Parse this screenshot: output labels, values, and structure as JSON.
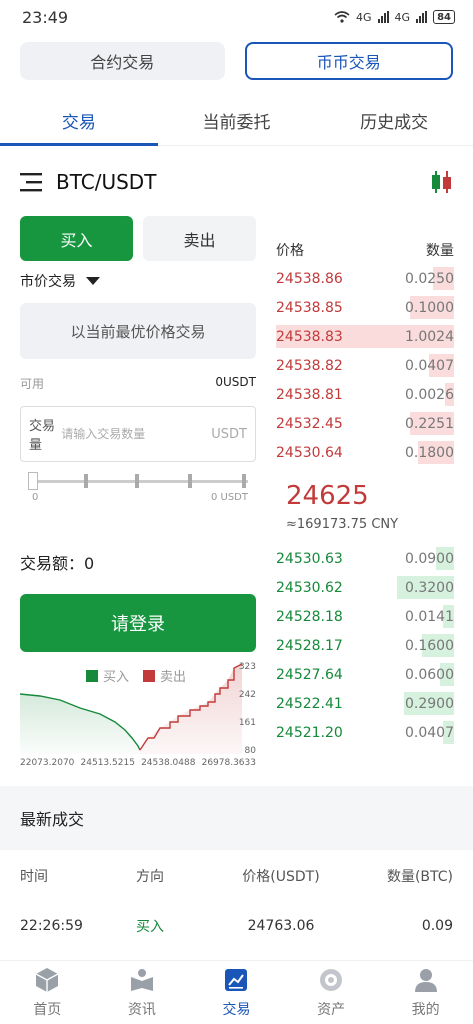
{
  "status_bar": {
    "time": "23:49",
    "network_1": "4G",
    "network_2": "4G",
    "battery": "84"
  },
  "segments": [
    {
      "label": "合约交易",
      "active": false
    },
    {
      "label": "币币交易",
      "active": true
    }
  ],
  "tabs": [
    {
      "label": "交易",
      "active": true
    },
    {
      "label": "当前委托",
      "active": false
    },
    {
      "label": "历史成交",
      "active": false
    }
  ],
  "pair": {
    "name": "BTC/USDT"
  },
  "trade_form": {
    "buy_label": "买入",
    "sell_label": "卖出",
    "order_type": "市价交易",
    "market_hint": "以当前最优价格交易",
    "available_label": "可用",
    "available_value": "0USDT",
    "qty_label": "交易量",
    "qty_placeholder": "请输入交易数量",
    "qty_unit": "USDT",
    "slider_value_fraction": 0,
    "slider_min": "0",
    "slider_max": "0 USDT",
    "amount_label": "交易额：0",
    "login_label": "请登录"
  },
  "depth_chart": {
    "legend_buy": "买入",
    "legend_sell": "卖出",
    "x_ticks": [
      "22073.2070",
      "24513.5215",
      "24538.0488",
      "26978.3633"
    ],
    "y_ticks": [
      "323",
      "242",
      "161",
      "80"
    ],
    "colors": {
      "buy": "#16893a",
      "sell": "#c23a3a"
    }
  },
  "order_book": {
    "price_header": "价格",
    "qty_header": "数量",
    "asks": [
      {
        "price": "24538.86",
        "qty": "0.0250",
        "depth": 0.12
      },
      {
        "price": "24538.85",
        "qty": "0.1000",
        "depth": 0.25
      },
      {
        "price": "24538.83",
        "qty": "1.0024",
        "depth": 1.0
      },
      {
        "price": "24538.82",
        "qty": "0.0407",
        "depth": 0.14
      },
      {
        "price": "24538.81",
        "qty": "0.0026",
        "depth": 0.05
      },
      {
        "price": "24532.45",
        "qty": "0.2251",
        "depth": 0.25
      },
      {
        "price": "24530.64",
        "qty": "0.1800",
        "depth": 0.2
      }
    ],
    "last_price": "24625",
    "last_price_cny": "≈169173.75 CNY",
    "bids": [
      {
        "price": "24530.63",
        "qty": "0.0900",
        "depth": 0.1
      },
      {
        "price": "24530.62",
        "qty": "0.3200",
        "depth": 0.32
      },
      {
        "price": "24528.18",
        "qty": "0.0141",
        "depth": 0.06
      },
      {
        "price": "24528.17",
        "qty": "0.1600",
        "depth": 0.18
      },
      {
        "price": "24527.64",
        "qty": "0.0600",
        "depth": 0.08
      },
      {
        "price": "24522.41",
        "qty": "0.2900",
        "depth": 0.28
      },
      {
        "price": "24521.20",
        "qty": "0.0407",
        "depth": 0.06
      }
    ]
  },
  "recent_trades": {
    "title": "最新成交",
    "headers": {
      "time": "时间",
      "side": "方向",
      "price": "价格(USDT)",
      "qty": "数量(BTC)"
    },
    "rows": [
      {
        "time": "22:26:59",
        "side": "买入",
        "price": "24763.06",
        "qty": "0.09"
      }
    ]
  },
  "bottom_nav": [
    {
      "label": "首页",
      "icon": "home-cube-icon",
      "active": false
    },
    {
      "label": "资讯",
      "icon": "news-book-icon",
      "active": false
    },
    {
      "label": "交易",
      "icon": "trade-chart-icon",
      "active": true
    },
    {
      "label": "资产",
      "icon": "assets-coin-icon",
      "active": false
    },
    {
      "label": "我的",
      "icon": "profile-person-icon",
      "active": false
    }
  ]
}
